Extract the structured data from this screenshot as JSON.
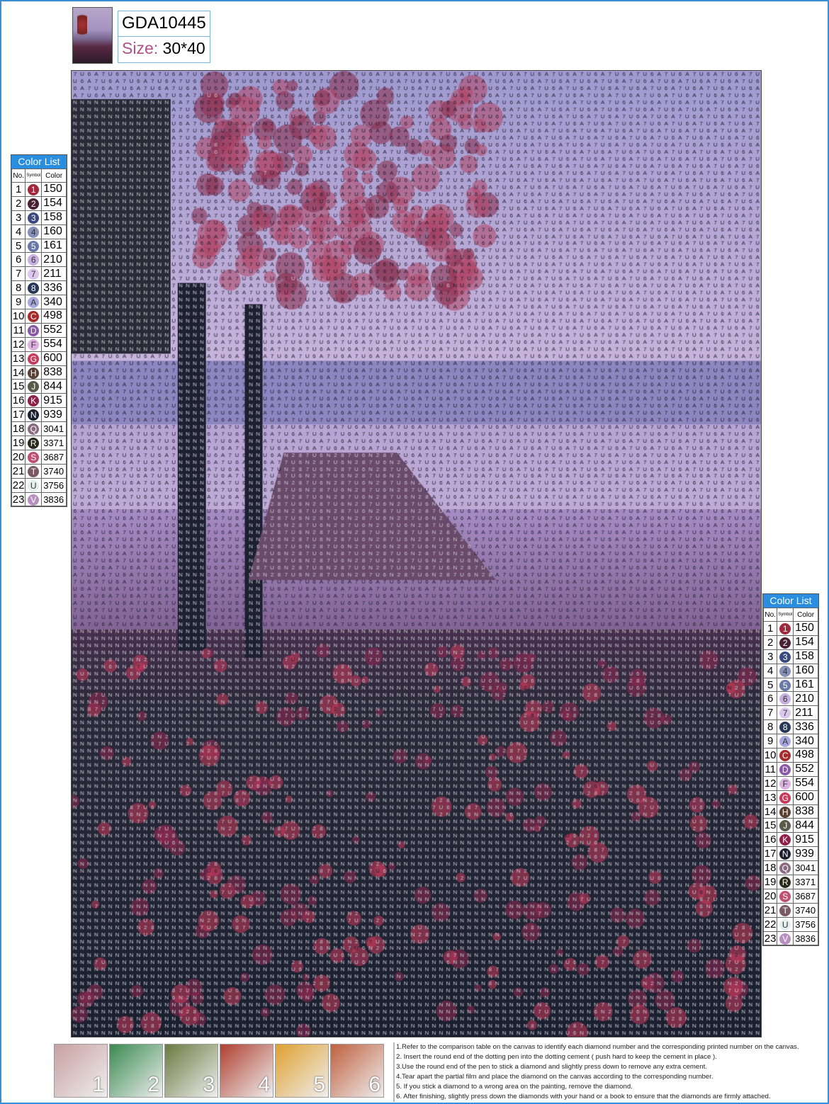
{
  "header": {
    "code": "GDA10445",
    "size_label": "Size:",
    "size_value": "30*40"
  },
  "color_list": {
    "title": "Color List",
    "columns": [
      "No.",
      "Symbol",
      "Color"
    ],
    "rows": [
      {
        "no": "1",
        "symbol": "1",
        "color": "150",
        "hex": "#a3283c"
      },
      {
        "no": "2",
        "symbol": "2",
        "color": "154",
        "hex": "#4a2232"
      },
      {
        "no": "3",
        "symbol": "3",
        "color": "158",
        "hex": "#3a4a80"
      },
      {
        "no": "4",
        "symbol": "4",
        "color": "160",
        "hex": "#8490b8"
      },
      {
        "no": "5",
        "symbol": "5",
        "color": "161",
        "hex": "#6878a8"
      },
      {
        "no": "6",
        "symbol": "6",
        "color": "210",
        "hex": "#c8b0e0"
      },
      {
        "no": "7",
        "symbol": "7",
        "color": "211",
        "hex": "#dcc8ec"
      },
      {
        "no": "8",
        "symbol": "8",
        "color": "336",
        "hex": "#253858"
      },
      {
        "no": "9",
        "symbol": "A",
        "color": "340",
        "hex": "#a8a8e0"
      },
      {
        "no": "10",
        "symbol": "C",
        "color": "498",
        "hex": "#a82a2a"
      },
      {
        "no": "11",
        "symbol": "D",
        "color": "552",
        "hex": "#8a5aa8"
      },
      {
        "no": "12",
        "symbol": "F",
        "color": "554",
        "hex": "#dcb0e0"
      },
      {
        "no": "13",
        "symbol": "G",
        "color": "600",
        "hex": "#c83a5a"
      },
      {
        "no": "14",
        "symbol": "H",
        "color": "838",
        "hex": "#5a4030"
      },
      {
        "no": "15",
        "symbol": "J",
        "color": "844",
        "hex": "#5a5a48"
      },
      {
        "no": "16",
        "symbol": "K",
        "color": "915",
        "hex": "#902048"
      },
      {
        "no": "17",
        "symbol": "N",
        "color": "939",
        "hex": "#1a2030"
      },
      {
        "no": "18",
        "symbol": "Q",
        "color": "3041",
        "hex": "#8a6a80"
      },
      {
        "no": "19",
        "symbol": "R",
        "color": "3371",
        "hex": "#2a2a1a"
      },
      {
        "no": "20",
        "symbol": "S",
        "color": "3687",
        "hex": "#c05070"
      },
      {
        "no": "21",
        "symbol": "T",
        "color": "3740",
        "hex": "#7a5a62"
      },
      {
        "no": "22",
        "symbol": "U",
        "color": "3756",
        "hex": "#e4f0f0"
      },
      {
        "no": "23",
        "symbol": "V",
        "color": "3836",
        "hex": "#b890c0"
      }
    ]
  },
  "steps": [
    "1",
    "2",
    "3",
    "4",
    "5",
    "6"
  ],
  "instructions": [
    "1.Refer to the comparison table on the canvas to identify each diamond number and the corresponding printed number on the canvas.",
    "2. Insert the round end of the dotting pen into the dotting cement ( push hard to keep the cement in place ).",
    "3.Use the round end of the pen to stick a diamond and slightly press down to remove any extra cement.",
    "4.Tear apart the partial film and place the diamond on the canvas according to the corresponding number.",
    "5. If you stick a diamond to a wrong area on the painting,   remove the diamond.",
    "6. After finishing, slightly press down the diamonds with your hand or a book to ensure that the diamonds are firmly attached."
  ]
}
